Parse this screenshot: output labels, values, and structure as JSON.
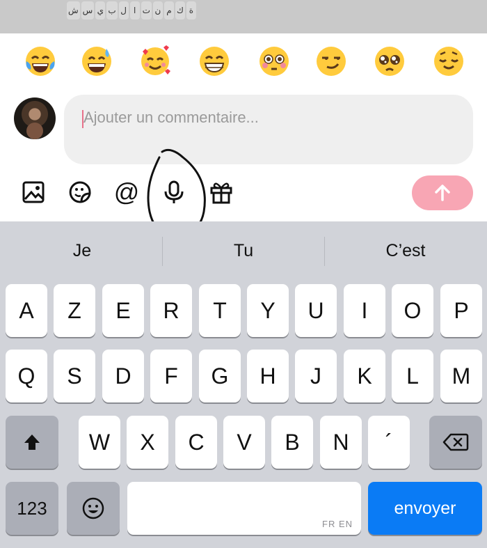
{
  "top_strip": {
    "arabic_letters": [
      "ة",
      "ك",
      "م",
      "ن",
      "ت",
      "ا",
      "ل",
      "ب",
      "ي",
      "س",
      "ش"
    ]
  },
  "emoji_bar": {
    "items": [
      {
        "name": "face-with-tears-of-joy"
      },
      {
        "name": "grinning-face-with-sweat"
      },
      {
        "name": "smiling-face-with-hearts"
      },
      {
        "name": "beaming-face-with-smiling-eyes"
      },
      {
        "name": "flushed-face"
      },
      {
        "name": "smirking-face"
      },
      {
        "name": "pleading-face"
      },
      {
        "name": "relieved-face"
      }
    ]
  },
  "comment": {
    "placeholder": "Ajouter un commentaire..."
  },
  "toolbar": {
    "icons": [
      "image-icon",
      "sticker-icon",
      "at-icon",
      "microphone-icon",
      "gift-icon"
    ],
    "at_label": "@",
    "send_icon": "arrow-up-icon",
    "send_color": "#f8a6b4"
  },
  "keyboard": {
    "suggestions": [
      "Je",
      "Tu",
      "C’est"
    ],
    "row1": [
      "A",
      "Z",
      "E",
      "R",
      "T",
      "Y",
      "U",
      "I",
      "O",
      "P"
    ],
    "row2": [
      "Q",
      "S",
      "D",
      "F",
      "G",
      "H",
      "J",
      "K",
      "L",
      "M"
    ],
    "row3": [
      "W",
      "X",
      "C",
      "V",
      "B",
      "N",
      "´"
    ],
    "numbers_label": "123",
    "space_hint": "FR EN",
    "return_label": "envoyer",
    "return_color": "#0a7bf5"
  }
}
